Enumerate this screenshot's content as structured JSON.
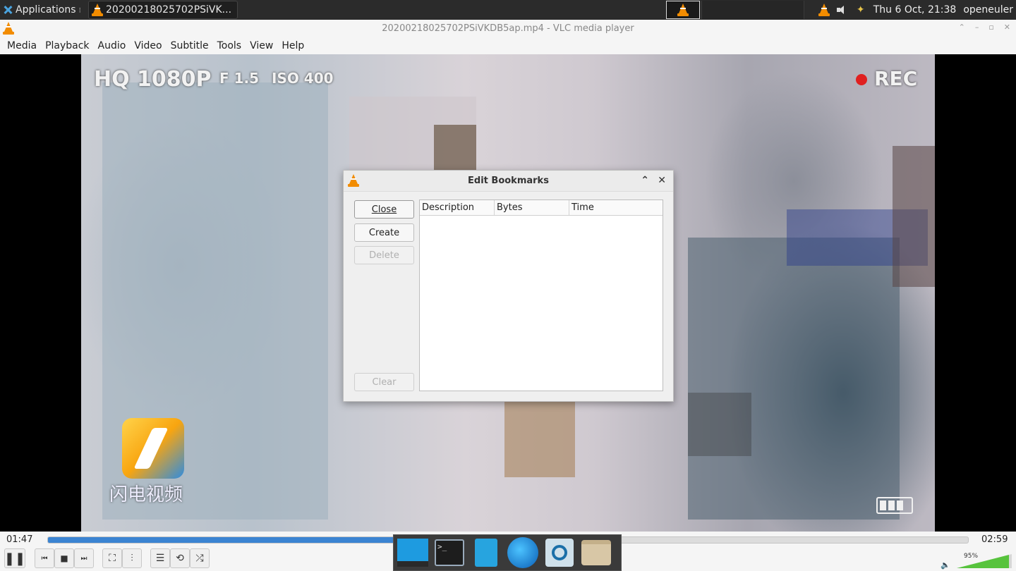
{
  "top_panel": {
    "apps_label": "Applications",
    "task_title": "20200218025702PSiVK...",
    "clock": "Thu  6 Oct, 21:38",
    "user": "openeuler"
  },
  "window": {
    "title": "20200218025702PSiVKDB5ap.mp4 - VLC media player"
  },
  "menu": {
    "items": [
      "Media",
      "Playback",
      "Audio",
      "Video",
      "Subtitle",
      "Tools",
      "View",
      "Help"
    ]
  },
  "video": {
    "osd_hq": "HQ 1080P",
    "osd_fstop": "F 1.5",
    "osd_iso": "ISO 400",
    "osd_rec": "REC",
    "watermark": "闪电视频"
  },
  "dialog": {
    "title": "Edit Bookmarks",
    "buttons": {
      "close": "Close",
      "create": "Create",
      "delete": "Delete",
      "clear": "Clear"
    },
    "columns": [
      "Description",
      "Bytes",
      "Time"
    ]
  },
  "playback": {
    "elapsed": "01:47",
    "total": "02:59",
    "progress": 0.598,
    "volume_pct": "95%",
    "volume_level": 0.95
  },
  "colors": {
    "accent": "#3b84d2",
    "vlc_orange": "#f28c00",
    "volume_green": "#57c33d"
  }
}
